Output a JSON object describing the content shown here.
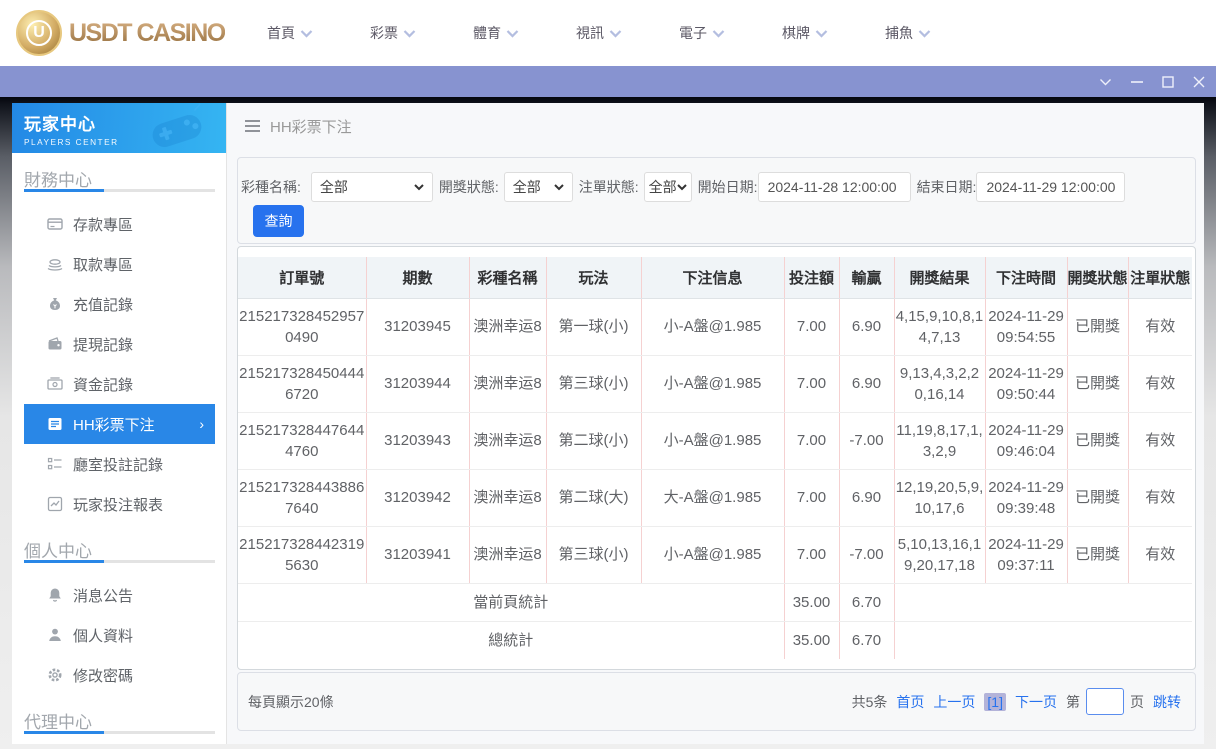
{
  "topnav": {
    "logo_text": "USDT CASINO",
    "logo_monogram": "U",
    "items": [
      {
        "label": "首頁"
      },
      {
        "label": "彩票"
      },
      {
        "label": "體育"
      },
      {
        "label": "視訊"
      },
      {
        "label": "電子"
      },
      {
        "label": "棋牌"
      },
      {
        "label": "捕魚"
      }
    ]
  },
  "sidebar": {
    "title": "玩家中心",
    "subtitle": "PLAYERS CENTER",
    "sections": [
      {
        "label": "財務中心"
      },
      {
        "label": "個人中心"
      },
      {
        "label": "代理中心"
      }
    ],
    "finance_items": [
      {
        "label": "存款專區"
      },
      {
        "label": "取款專區"
      },
      {
        "label": "充值記錄"
      },
      {
        "label": "提現記錄"
      },
      {
        "label": "資金記錄"
      },
      {
        "label": "HH彩票下注"
      },
      {
        "label": "廳室投註記錄"
      },
      {
        "label": "玩家投注報表"
      }
    ],
    "personal_items": [
      {
        "label": "消息公告"
      },
      {
        "label": "個人資料"
      },
      {
        "label": "修改密碼"
      }
    ]
  },
  "breadcrumb": {
    "title": "HH彩票下注"
  },
  "filters": {
    "lottery_label": "彩種名稱:",
    "lottery_value": "全部",
    "draw_status_label": "開獎狀態:",
    "draw_status_value": "全部",
    "order_status_label": "注單狀態:",
    "order_status_value": "全部",
    "start_label": "開始日期:",
    "start_value": "2024-11-28 12:00:00",
    "end_label": "結束日期:",
    "end_value": "2024-11-29 12:00:00",
    "search_label": "查詢"
  },
  "table": {
    "headers": [
      "訂單號",
      "期數",
      "彩種名稱",
      "玩法",
      "下注信息",
      "投注額",
      "輸贏",
      "開獎結果",
      "下注時間",
      "開獎狀態",
      "注單狀態"
    ],
    "rows": [
      [
        "2152173284529570490",
        "31203945",
        "澳洲幸运8",
        "第一球(小)",
        "小-A盤@1.985",
        "7.00",
        "6.90",
        "4,15,9,10,8,14,7,13",
        "2024-11-29 09:54:55",
        "已開獎",
        "有效"
      ],
      [
        "2152173284504446720",
        "31203944",
        "澳洲幸运8",
        "第三球(小)",
        "小-A盤@1.985",
        "7.00",
        "6.90",
        "9,13,4,3,2,20,16,14",
        "2024-11-29 09:50:44",
        "已開獎",
        "有效"
      ],
      [
        "2152173284476444760",
        "31203943",
        "澳洲幸运8",
        "第二球(小)",
        "小-A盤@1.985",
        "7.00",
        "-7.00",
        "11,19,8,17,1,3,2,9",
        "2024-11-29 09:46:04",
        "已開獎",
        "有效"
      ],
      [
        "2152173284438867640",
        "31203942",
        "澳洲幸运8",
        "第二球(大)",
        "大-A盤@1.985",
        "7.00",
        "6.90",
        "12,19,20,5,9,10,17,6",
        "2024-11-29 09:39:48",
        "已開獎",
        "有效"
      ],
      [
        "2152173284423195630",
        "31203941",
        "澳洲幸运8",
        "第三球(小)",
        "小-A盤@1.985",
        "7.00",
        "-7.00",
        "5,10,13,16,19,20,17,18",
        "2024-11-29 09:37:11",
        "已開獎",
        "有效"
      ]
    ],
    "summary": [
      {
        "label": "當前頁統計",
        "bet": "35.00",
        "winloss": "6.70"
      },
      {
        "label": "總統計",
        "bet": "35.00",
        "winloss": "6.70"
      }
    ]
  },
  "pagination": {
    "page_size_text": "每頁顯示20條",
    "total_text": "共5条",
    "first": "首页",
    "prev": "上一页",
    "current": "[1]",
    "next": "下一页",
    "jump_pre": "第",
    "jump_post": "页",
    "jump_label": "跳转",
    "jump_value": ""
  }
}
